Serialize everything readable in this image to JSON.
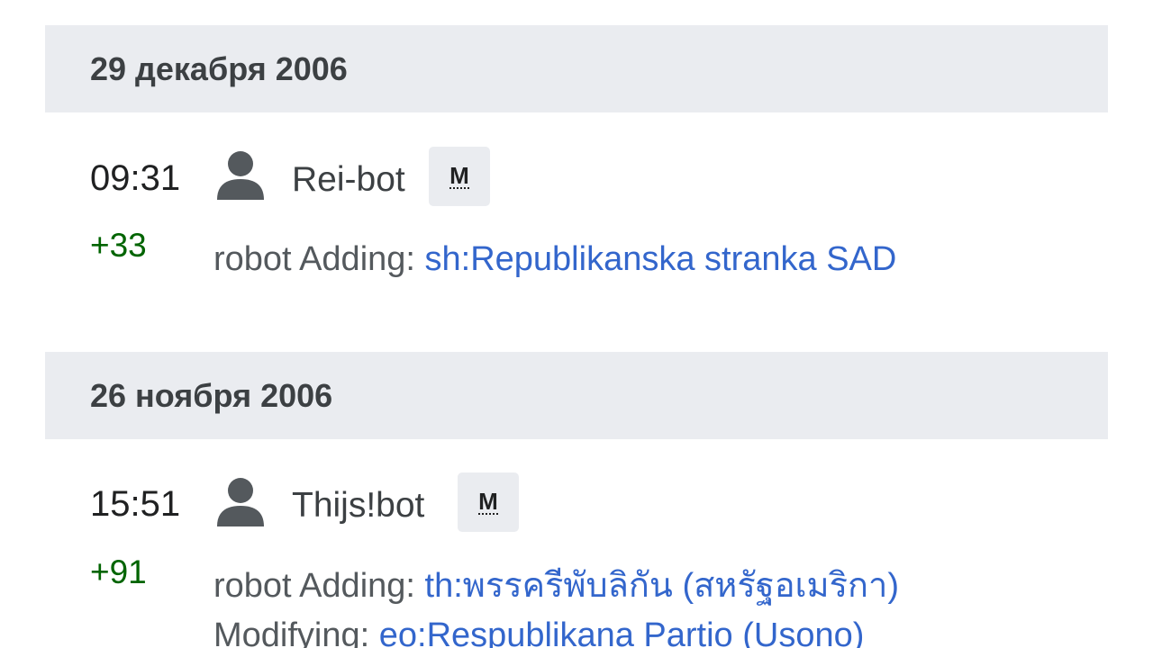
{
  "groups": [
    {
      "date": "29 декабря 2006",
      "entries": [
        {
          "time": "09:31",
          "user": "Rei-bot",
          "badge": "M",
          "diff": "+33",
          "summary_prefix": "robot Adding: ",
          "summary_link": "sh:Republikanska stranka SAD"
        }
      ]
    },
    {
      "date": "26 ноября 2006",
      "entries": [
        {
          "time": "15:51",
          "user": "Thijs!bot",
          "badge": "M",
          "diff": "+91",
          "summary_prefix": "robot Adding: ",
          "summary_link": "th:พรรครีพับลิกัน (สหรัฐอเมริกา)",
          "summary2_prefix": "Modifying: ",
          "summary2_link": "eo:Respublikana Partio (Usono)"
        }
      ]
    }
  ],
  "icons": {
    "user": "user-icon",
    "accent": "#3366cc",
    "positive_diff": "#006400",
    "header_bg": "#eaecf0"
  }
}
